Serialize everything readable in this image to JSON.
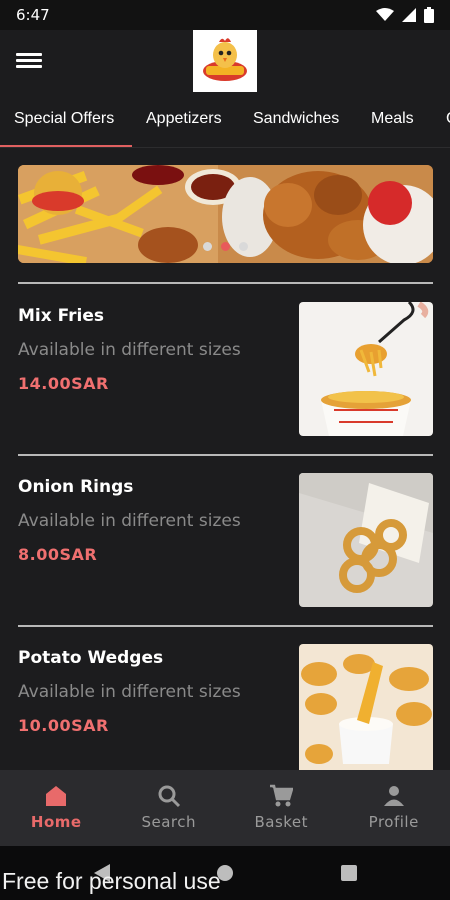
{
  "status": {
    "time": "6:47"
  },
  "tabs": [
    "Special Offers",
    "Appetizers",
    "Sandwiches",
    "Meals",
    "C"
  ],
  "items": [
    {
      "name": "Mix Fries",
      "desc": "Available in different sizes",
      "price": "14.00SAR"
    },
    {
      "name": "Onion Rings",
      "desc": "Available in different sizes",
      "price": "8.00SAR"
    },
    {
      "name": "Potato Wedges",
      "desc": "Available in different sizes",
      "price": "10.00SAR"
    }
  ],
  "banner": {
    "active_dot": 2,
    "dot_count": 3
  },
  "nav": [
    {
      "label": "Home",
      "icon": "home-icon"
    },
    {
      "label": "Search",
      "icon": "search-icon"
    },
    {
      "label": "Basket",
      "icon": "cart-icon"
    },
    {
      "label": "Profile",
      "icon": "person-icon"
    }
  ],
  "watermark": "Free for personal use",
  "colors": {
    "accent": "#e06060",
    "price": "#f07070",
    "background": "#1c1c1e",
    "nav_background": "#2b2b2e"
  }
}
